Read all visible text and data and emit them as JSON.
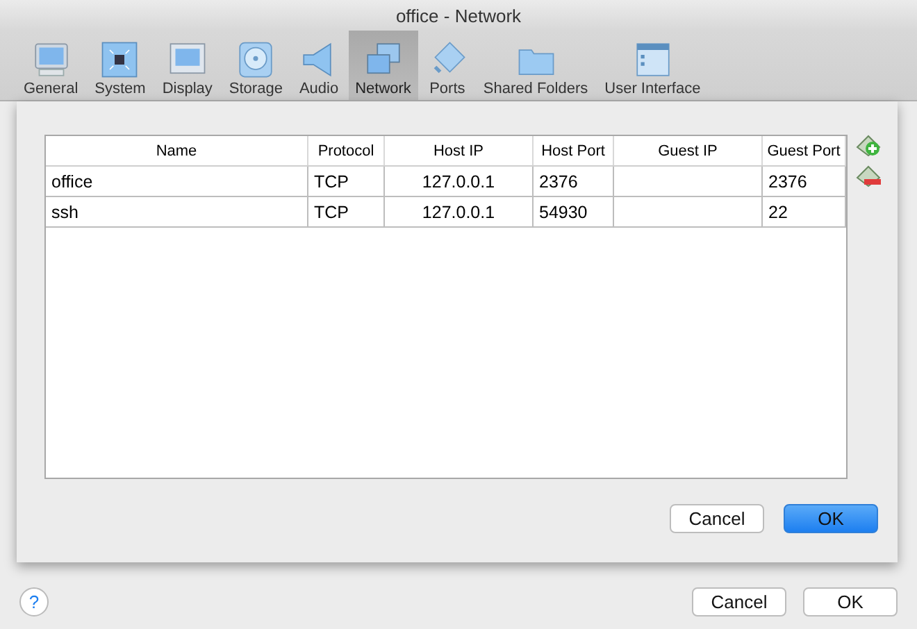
{
  "window": {
    "title": "office - Network"
  },
  "toolbar": [
    {
      "label": "General",
      "selected": false
    },
    {
      "label": "System",
      "selected": false
    },
    {
      "label": "Display",
      "selected": false
    },
    {
      "label": "Storage",
      "selected": false
    },
    {
      "label": "Audio",
      "selected": false
    },
    {
      "label": "Network",
      "selected": true
    },
    {
      "label": "Ports",
      "selected": false
    },
    {
      "label": "Shared Folders",
      "selected": false
    },
    {
      "label": "User Interface",
      "selected": false
    }
  ],
  "rules_table": {
    "columns": [
      "Name",
      "Protocol",
      "Host IP",
      "Host Port",
      "Guest IP",
      "Guest Port"
    ],
    "rows": [
      [
        "office",
        "TCP",
        "127.0.0.1",
        "2376",
        "",
        "2376"
      ],
      [
        "ssh",
        "TCP",
        "127.0.0.1",
        "54930",
        "",
        "22"
      ]
    ]
  },
  "sheet_buttons": [
    {
      "label": "Cancel",
      "default": false
    },
    {
      "label": "OK",
      "default": true
    }
  ],
  "help_button": "?",
  "dialog_buttons": [
    {
      "label": "Cancel",
      "default": false
    },
    {
      "label": "OK",
      "default": false
    }
  ]
}
